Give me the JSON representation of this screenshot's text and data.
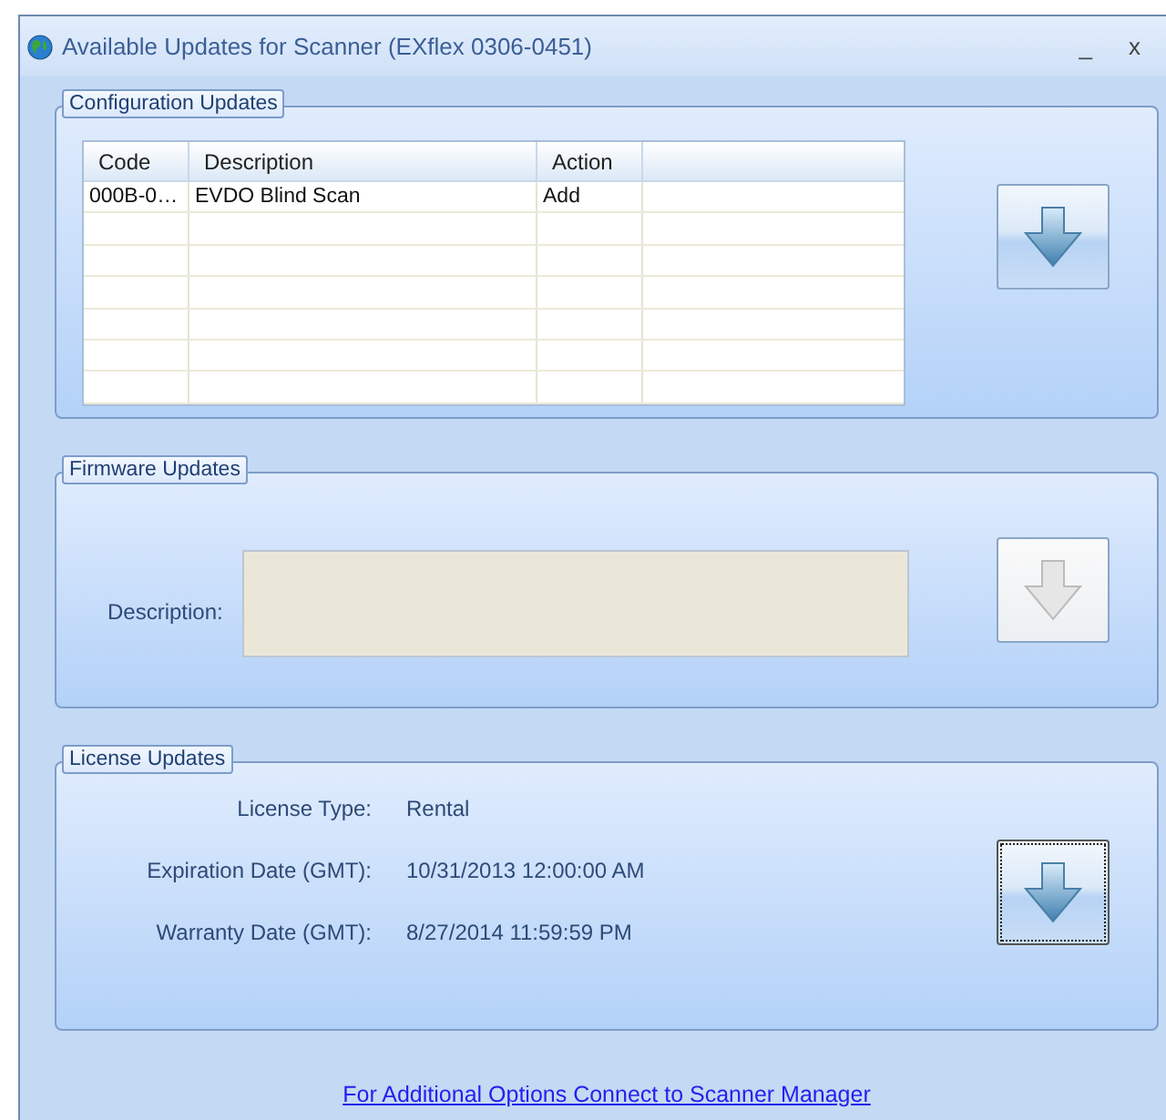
{
  "window": {
    "title": "Available Updates for Scanner (EXflex 0306-0451)",
    "controls": [
      "_",
      "x"
    ]
  },
  "configuration_updates": {
    "title": "Configuration Updates",
    "table": {
      "columns": [
        "Code",
        "Description",
        "Action"
      ],
      "rows": [
        {
          "cells": [
            "000B-0…",
            "EVDO Blind Scan",
            "Add"
          ]
        }
      ]
    },
    "button": {
      "disabled": false,
      "focused": false
    }
  },
  "firmware_updates": {
    "title": "Firmware Updates",
    "label": "Description:",
    "button": {
      "disabled": true,
      "focused": false
    }
  },
  "license_updates": {
    "title": "License Updates",
    "fields": [
      {
        "label": "License Type:",
        "value": "Rental"
      },
      {
        "label": "Expiration Date (GMT):",
        "value": "10/31/2013 12:00:00 AM"
      },
      {
        "label": "Warranty Date (GMT):",
        "value": "8/27/2014 11:59:59 PM"
      }
    ],
    "button": {
      "disabled": false,
      "focused": true
    }
  },
  "link": "For Additional Options Connect to Scanner Manager"
}
